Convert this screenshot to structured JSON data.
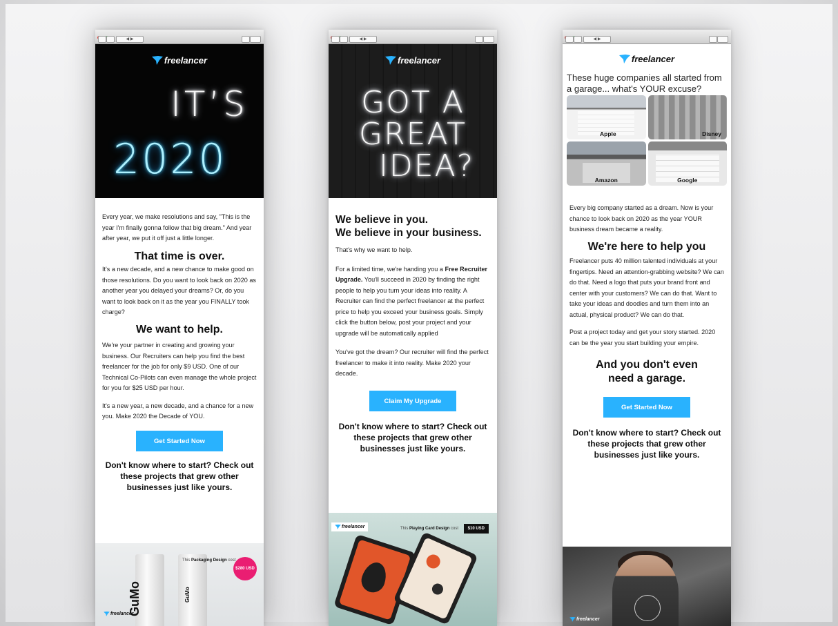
{
  "brand": {
    "logo_text": "freelancer",
    "accent": "#29b2fe"
  },
  "chrome": {
    "toolbar_glyph": "◀ ▶"
  },
  "email1": {
    "hero_line1": "IT’S",
    "hero_line2": "2020",
    "p1": "Every year, we make resolutions and say, \"This is the year I'm finally gonna follow that big dream.\" And year after year, we put it off just a little longer.",
    "h1": "That time is over.",
    "p2": "It's a new decade, and a new chance to make good on those resolutions. Do you want to look back on 2020 as another year you delayed your dreams? Or, do you want to look back on it as the year you FINALLY took charge?",
    "h2": "We want to help.",
    "p3": "We're your partner in creating and growing your business. Our Recruiters can help you find the best freelancer for the job for only $9 USD. One of our Technical Co-Pilots can even manage the whole project for you for $25 USD per hour.",
    "p4": "It's a new year, a new decade, and a chance for a new you. Make 2020 the Decade of YOU.",
    "button": "Get Started Now",
    "cta": "Don't know where to start? Check out these projects that grew other businesses just like yours.",
    "banner_caption_prefix": "This",
    "banner_caption_bold": "Packaging Design",
    "banner_caption_suffix": "cost",
    "banner_price": "$280 USD",
    "can_text": "GuMo",
    "can_text_small": "GuMo"
  },
  "email2": {
    "hero_lines": [
      "GOT A",
      "GREAT",
      "IDEA?"
    ],
    "h1_line1": "We believe in you.",
    "h1_line2": "We believe in your business.",
    "p1": "That's why we want to help.",
    "p2_start": "For a limited time, we're handing you a",
    "p2_bold": "Free Recruiter Upgrade.",
    "p2_end": "You'll succeed in 2020 by finding the right people to help you turn your ideas into reality. A Recruiter can find the perfect freelancer at the perfect price to help you exceed your business goals. Simply click the button below, post your project and your upgrade will be automatically applied",
    "p3": "You've got the dream? Our recruiter will find the perfect freelancer to make it into reality.  Make 2020 your decade.",
    "button": "Claim My Upgrade",
    "cta": "Don't know where to start? Check out these projects that grew other businesses just like yours.",
    "banner_caption_prefix": "This",
    "banner_caption_bold": "Playing Card Design",
    "banner_caption_suffix": "cost",
    "banner_price": "$10 USD"
  },
  "email3": {
    "hero_title": "These huge companies all started from a garage... what's YOUR excuse?",
    "garages": [
      "Apple",
      "Disney",
      "Amazon",
      "Google"
    ],
    "p1": "Every big company started as a dream. Now is your chance to look back on 2020 as the year YOUR business dream became a reality.",
    "h1": "We're here to help you",
    "p2": "Freelancer puts 40 million talented individuals at your fingertips. Need an attention-grabbing website? We can do that. Need a logo that puts your brand front and center with your customers? We can do that. Want to take your ideas and doodles and turn them into an actual, physical product? We can do that.",
    "p3": "Post a project today and get your story started. 2020 can be the year you start building your empire.",
    "h2_line1": "And you don't even",
    "h2_line2": "need a garage.",
    "button": "Get Started Now",
    "cta": "Don't know where to start? Check out these projects that grew other businesses just like yours."
  }
}
